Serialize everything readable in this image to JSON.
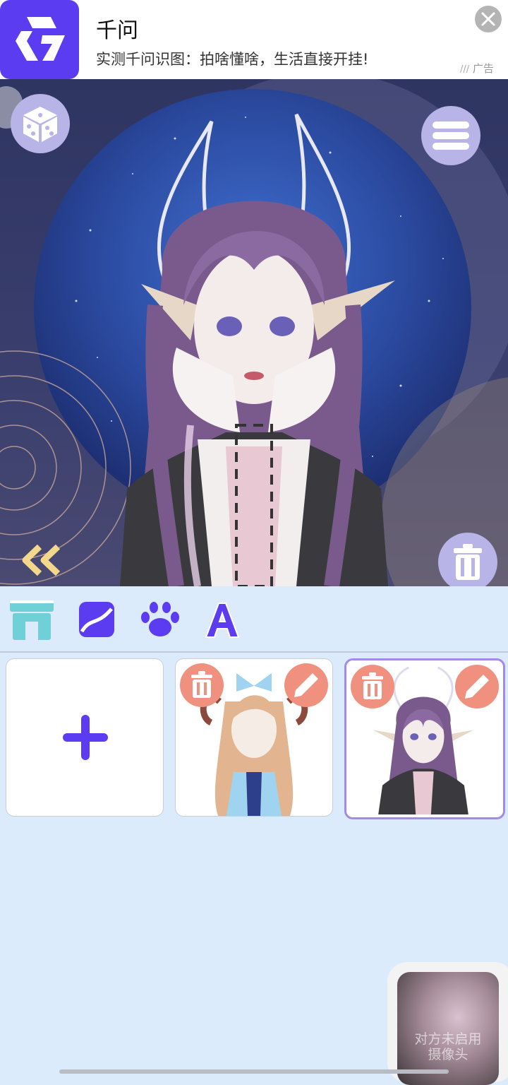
{
  "ad": {
    "title": "千问",
    "subtitle": "实测千问识图：拍啥懂啥，生活直接开挂!",
    "tag": "广告"
  },
  "stage": {
    "icons": [
      "dice-icon",
      "list-icon",
      "trash-icon",
      "double-chevron-left-icon"
    ]
  },
  "toolbar": {
    "icons": [
      "shop-icon",
      "image-icon",
      "paw-icon",
      "text-icon"
    ]
  },
  "gallery": {
    "cards": [
      {
        "type": "add",
        "icon": "plus-icon"
      },
      {
        "type": "character",
        "selected": false
      },
      {
        "type": "character",
        "selected": true
      }
    ]
  },
  "video_overlay": {
    "line1": "对方未启用",
    "line2": "摄像头"
  },
  "colors": {
    "accent": "#5b3cf0",
    "button": "#b8b4e8",
    "card_action": "#f0917f",
    "panel_bg": "#dcebfb"
  }
}
